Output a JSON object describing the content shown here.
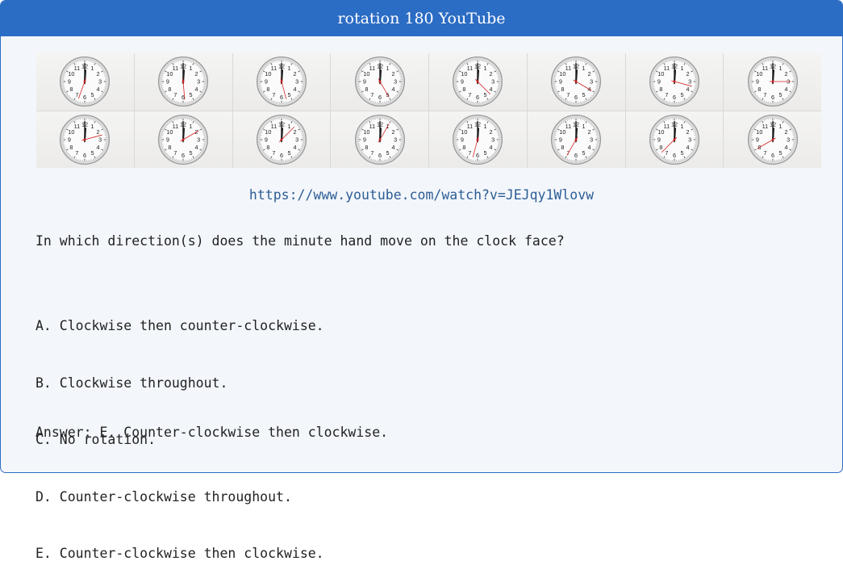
{
  "card": {
    "title": "rotation 180 YouTube",
    "accent_color": "#2b6cc4"
  },
  "video_frames": {
    "count": 16,
    "content": "analog wall clock",
    "clock_numerals": [
      "12",
      "1",
      "2",
      "3",
      "4",
      "5",
      "6",
      "7",
      "8",
      "9",
      "10",
      "11"
    ]
  },
  "link": {
    "url": "https://www.youtube.com/watch?v=JEJqy1Wlovw"
  },
  "question": "In which direction(s) does the minute hand move on the clock face?",
  "options": [
    "A. Clockwise then counter-clockwise.",
    "B. Clockwise throughout.",
    "C. No rotation.",
    "D. Counter-clockwise throughout.",
    "E. Counter-clockwise then clockwise."
  ],
  "answer": "Answer: E. Counter-clockwise then clockwise."
}
